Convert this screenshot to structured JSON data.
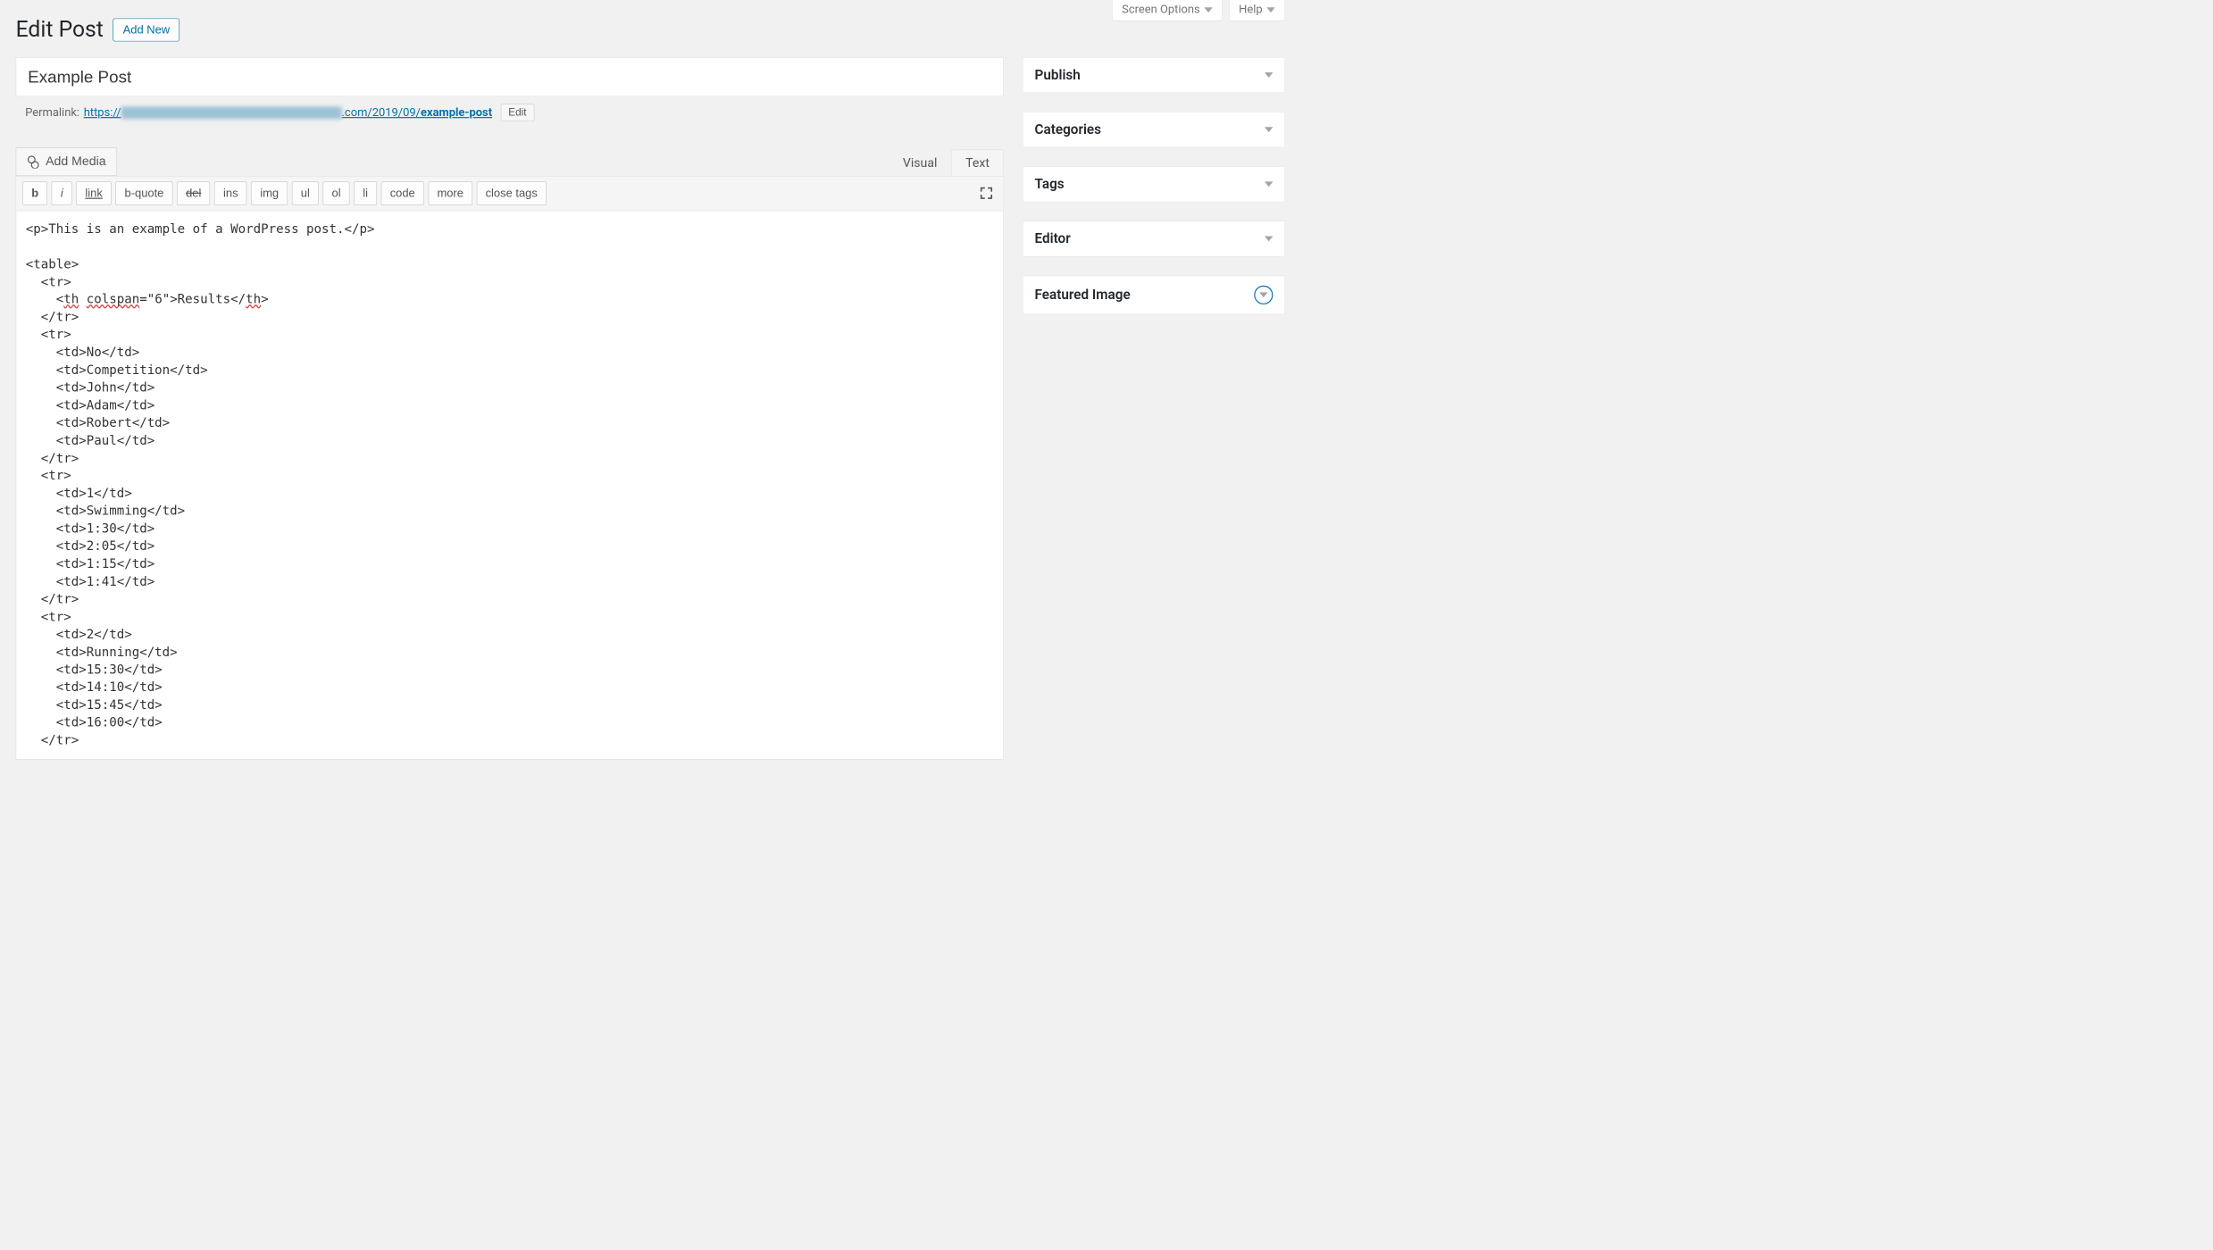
{
  "top": {
    "screen_options": "Screen Options",
    "help": "Help"
  },
  "heading": {
    "title": "Edit Post",
    "add_new": "Add New"
  },
  "post": {
    "title": "Example Post",
    "permalink_label": "Permalink:",
    "permalink_prefix": "https://",
    "permalink_mid": ".com/2019/09/",
    "permalink_slug": "example-post",
    "edit_label": "Edit"
  },
  "media": {
    "add_media": "Add Media"
  },
  "tabs": {
    "visual": "Visual",
    "text": "Text"
  },
  "quicktags": {
    "b": "b",
    "i": "i",
    "link": "link",
    "bquote": "b-quote",
    "del": "del",
    "ins": "ins",
    "img": "img",
    "ul": "ul",
    "ol": "ol",
    "li": "li",
    "code": "code",
    "more": "more",
    "close": "close tags"
  },
  "content": "<p>This is an example of a WordPress post.</p>\n\n<table>\n  <tr>\n    <th colspan=\"6\">Results</th>\n  </tr>\n  <tr>\n    <td>No</td>\n    <td>Competition</td>\n    <td>John</td>\n    <td>Adam</td>\n    <td>Robert</td>\n    <td>Paul</td>\n  </tr>\n  <tr>\n    <td>1</td>\n    <td>Swimming</td>\n    <td>1:30</td>\n    <td>2:05</td>\n    <td>1:15</td>\n    <td>1:41</td>\n  </tr>\n  <tr>\n    <td>2</td>\n    <td>Running</td>\n    <td>15:30</td>\n    <td>14:10</td>\n    <td>15:45</td>\n    <td>16:00</td>\n  </tr>",
  "sidebar": {
    "boxes": [
      {
        "title": "Publish"
      },
      {
        "title": "Categories"
      },
      {
        "title": "Tags"
      },
      {
        "title": "Editor"
      },
      {
        "title": "Featured Image"
      }
    ]
  }
}
